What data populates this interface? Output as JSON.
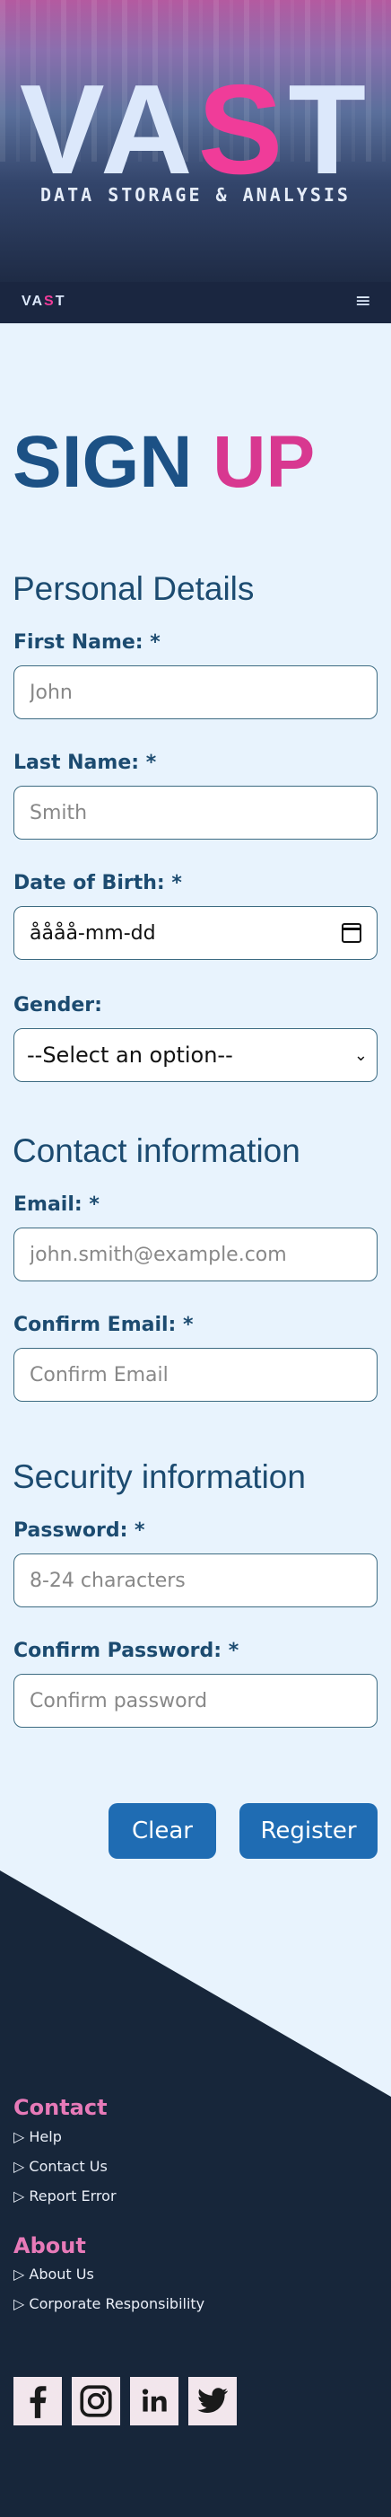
{
  "header": {
    "logo": {
      "part1": "VA",
      "part2": "S",
      "part3": "T"
    },
    "tagline": "DATA STORAGE & ANALYSIS"
  },
  "nav": {
    "brand": {
      "part1": "VA",
      "part2": "S",
      "part3": "T"
    },
    "menu_icon": "hamburger-icon",
    "menu_glyph": "≡"
  },
  "page": {
    "title_part1": "SIGN",
    "title_part2": "UP"
  },
  "form": {
    "personal": {
      "heading": "Personal Details",
      "first_name_label": "First Name: *",
      "first_name_placeholder": "John",
      "last_name_label": "Last Name: *",
      "last_name_placeholder": "Smith",
      "dob_label": "Date of Birth: *",
      "dob_value": "åååå-mm-dd",
      "gender_label": "Gender:",
      "gender_selected": "--Select an option--"
    },
    "contact": {
      "heading": "Contact information",
      "email_label": "Email: *",
      "email_placeholder": "john.smith@example.com",
      "confirm_email_label": "Confirm Email: *",
      "confirm_email_placeholder": "Confirm Email"
    },
    "security": {
      "heading": "Security information",
      "password_label": "Password: *",
      "password_placeholder": "8-24 characters",
      "confirm_password_label": "Confirm Password: *",
      "confirm_password_placeholder": "Confirm password"
    },
    "buttons": {
      "clear": "Clear",
      "register": "Register"
    }
  },
  "footer": {
    "contact": {
      "heading": "Contact",
      "links": [
        "▷ Help",
        "▷ Contact Us",
        "▷ Report Error"
      ]
    },
    "about": {
      "heading": "About",
      "links": [
        "▷ About Us",
        "▷ Corporate Responsibility"
      ]
    },
    "social": [
      "facebook-icon",
      "instagram-icon",
      "linkedin-icon",
      "twitter-icon"
    ]
  },
  "colors": {
    "accent": "#1f6cb3",
    "brand_pink": "#f03c99",
    "footer_bg": "#17263a",
    "page_bg": "#e8f3fd"
  }
}
